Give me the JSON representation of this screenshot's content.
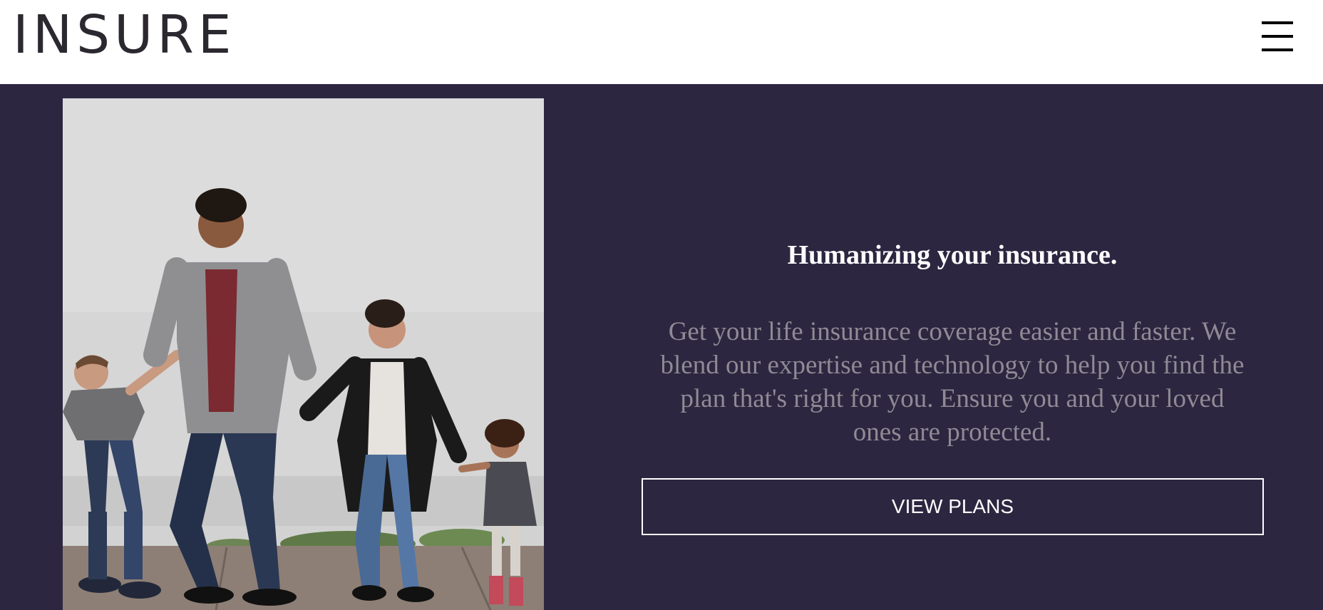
{
  "header": {
    "logo_text": "INSURE",
    "menu_icon": "hamburger-menu-icon"
  },
  "hero": {
    "image_alt": "Family walking hand in hand",
    "headline": "Humanizing your insurance.",
    "body": "Get your life insurance coverage easier and faster. We blend our expertise and technology to help you find the plan that's right for you. Ensure you and your loved ones are protected.",
    "cta_label": "VIEW PLANS"
  },
  "colors": {
    "header_bg": "#ffffff",
    "hero_bg": "#2c2640",
    "headline": "#ffffff",
    "body_text": "#8f8a94",
    "button_border": "#ffffff"
  }
}
